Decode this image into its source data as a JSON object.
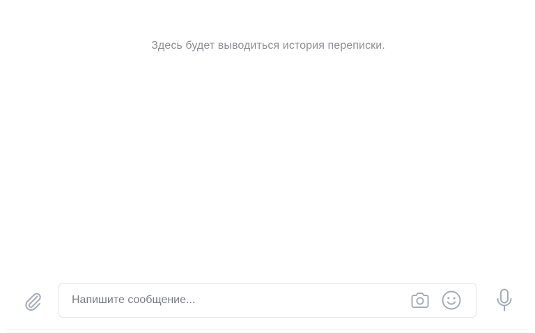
{
  "history": {
    "empty_text": "Здесь будет выводиться история переписки."
  },
  "composer": {
    "placeholder": "Напишите сообщение...",
    "value": ""
  },
  "icons": {
    "attach": "paperclip-icon",
    "camera": "camera-icon",
    "emoji": "smile-icon",
    "microphone": "microphone-icon"
  },
  "colors": {
    "icon": "#a4abb5",
    "muted_text": "#8c8f94",
    "input_border": "#e3e5e8"
  }
}
